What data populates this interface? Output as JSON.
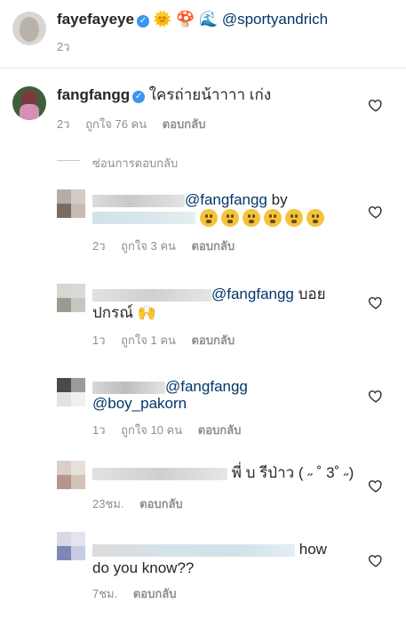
{
  "top_comment": {
    "username": "fayefayeye",
    "emojis": "🌞 🍄 🌊",
    "mention": "@sportyandrich",
    "time": "2ว"
  },
  "main_comment": {
    "username": "fangfangg",
    "text": "ใครถ่ายน้าาาา เก่ง",
    "time": "2ว",
    "likes": "ถูกใจ 76 คน",
    "reply": "ตอบกลับ"
  },
  "hide_replies": "ซ่อนการตอบกลับ",
  "replies": [
    {
      "mention": "@fangfangg",
      "text_after": " by",
      "time": "2ว",
      "likes": "ถูกใจ 3 คน",
      "reply": "ตอบกลับ"
    },
    {
      "mention": "@fangfangg",
      "text_after": " บอย",
      "line2": "ปกรณ์ 🙌",
      "time": "1ว",
      "likes": "ถูกใจ 1 คน",
      "reply": "ตอบกลับ"
    },
    {
      "mention": "@fangfangg",
      "line2_mention": "@boy_pakorn",
      "time": "1ว",
      "likes": "ถูกใจ 10 คน",
      "reply": "ตอบกลับ"
    },
    {
      "text": "พี่ บ รีป่าว ( ˶ ˚ 3˚ ˶)",
      "time": "23ชม.",
      "reply": "ตอบกลับ"
    },
    {
      "text_after": "how",
      "line2": "do you know??",
      "time": "7ชม.",
      "reply": "ตอบกลับ"
    }
  ]
}
